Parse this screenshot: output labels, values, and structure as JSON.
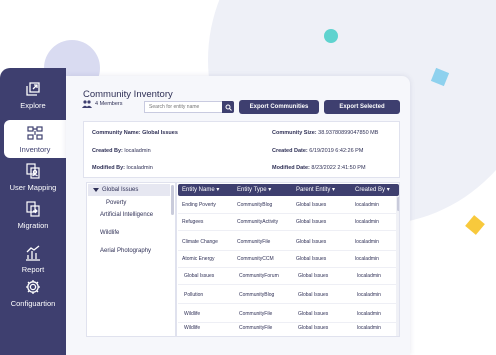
{
  "sidebar": {
    "items": [
      {
        "label": "Explore",
        "icon": "explore-icon",
        "active": false
      },
      {
        "label": "Inventory",
        "icon": "inventory-icon",
        "active": true
      },
      {
        "label": "User Mapping",
        "icon": "user-mapping-icon",
        "active": false
      },
      {
        "label": "Migration",
        "icon": "migration-icon",
        "active": false
      },
      {
        "label": "Report",
        "icon": "report-icon",
        "active": false
      },
      {
        "label": "Configuartion",
        "icon": "gear-icon",
        "active": false
      }
    ]
  },
  "header": {
    "title": "Community Inventory",
    "members": "4 Members",
    "search_placeholder": "Search for entity name",
    "export_communities": "Export Communities",
    "export_selected": "Export Selected"
  },
  "details": {
    "community_name_label": "Community Name:",
    "community_name": "Global Issues",
    "created_by_label": "Created By:",
    "created_by": "localadmin",
    "modified_by_label": "Modified By:",
    "modified_by": "localadmin",
    "size_label": "Community Size:",
    "size": "38.93780899047850 MB",
    "created_date_label": "Created Date:",
    "created_date": "6/19/2019 6:42:26 PM",
    "modified_date_label": "Modified Date:",
    "modified_date": "8/23/2022 2:41:50 PM"
  },
  "tree": {
    "root": "Global Issues",
    "children": [
      "Poverty",
      "Artificial Intelligence",
      "Wildlife",
      "Aerial Photography"
    ]
  },
  "table": {
    "headers": [
      "Entity Name",
      "Entity Type",
      "Parent Entity",
      "Created By"
    ],
    "rows": [
      [
        "Ending Poverty",
        "CommunityBlog",
        "Global Issues",
        "localadmin"
      ],
      [
        "Refugees",
        "CommunityActivity",
        "Global Issues",
        "localadmin"
      ],
      [
        "Climate Change",
        "CommunityFile",
        "Global Issues",
        "localadmin"
      ],
      [
        "Atomic Energy",
        "CommunityCCM",
        "Global Issues",
        "localadmin"
      ],
      [
        "Global Issues",
        "CommunityForum",
        "Global Issues",
        "localadmin"
      ],
      [
        "Pollution",
        "CommunityBlog",
        "Global Issues",
        "localadmin"
      ],
      [
        "Wildlife",
        "CommunityFile",
        "Global Issues",
        "localadmin"
      ],
      [
        "Wildlife",
        "CommunityFile",
        "Global Issues",
        "localadmin"
      ]
    ]
  },
  "colors": {
    "primary": "#3e3f6f",
    "accent_teal": "#5fd3cf",
    "accent_yellow": "#f8c93c",
    "accent_blue": "#8ed1ee"
  }
}
